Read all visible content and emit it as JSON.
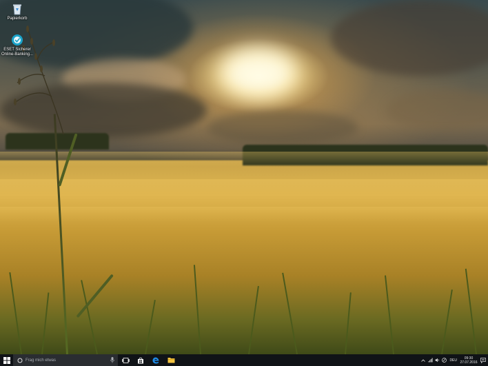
{
  "desktop": {
    "icons": [
      {
        "label": "Papierkorb",
        "icon": "recycle-bin-icon"
      },
      {
        "label": "ESET Sicherer Online-Banking...",
        "icon": "eset-banking-icon"
      }
    ]
  },
  "taskbar": {
    "search_placeholder": "Frag mich etwas",
    "pinned": [
      "task-view-icon",
      "store-icon",
      "edge-icon",
      "file-explorer-icon"
    ],
    "tray": {
      "language": "DEU",
      "time": "09:30",
      "date": "27.07.2016"
    }
  },
  "colors": {
    "taskbar": "#101317",
    "search_box": "#2a2d31",
    "edge_blue": "#1e8ae6",
    "explorer_yellow": "#f4c542"
  }
}
